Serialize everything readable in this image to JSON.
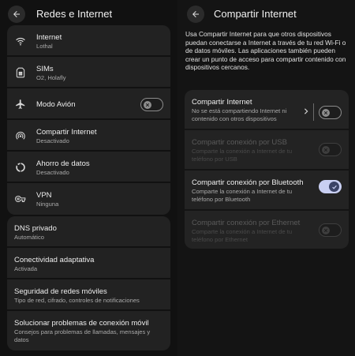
{
  "left": {
    "title": "Redes e Internet",
    "group1": [
      {
        "icon": "wifi-icon",
        "title": "Internet",
        "subtitle": "Lothal"
      },
      {
        "icon": "sim-card-icon",
        "title": "SIMs",
        "subtitle": "O2, Holafly"
      },
      {
        "icon": "airplane-icon",
        "title": "Modo Avión",
        "toggle": "off"
      },
      {
        "icon": "hotspot-icon",
        "title": "Compartir Internet",
        "subtitle": "Desactivado"
      },
      {
        "icon": "data-saver-icon",
        "title": "Ahorro de datos",
        "subtitle": "Desactivado"
      },
      {
        "icon": "vpn-key-icon",
        "title": "VPN",
        "subtitle": "Ninguna"
      }
    ],
    "group2": [
      {
        "title": "DNS privado",
        "subtitle": "Automático"
      },
      {
        "title": "Conectividad adaptativa",
        "subtitle": "Activada"
      },
      {
        "title": "Seguridad de redes móviles",
        "subtitle": "Tipo de red, cifrado, controles de notificaciones"
      },
      {
        "title": "Solucionar problemas de conexión móvil",
        "subtitle": "Consejos para problemas de llamadas, mensajes y datos"
      }
    ]
  },
  "right": {
    "title": "Compartir Internet",
    "intro": "Usa Compartir Internet para que otros dispositivos puedan conectarse a Internet a través de tu red Wi-Fi o de datos móviles. Las aplicaciones también pueden crear un punto de acceso para compartir contenido con dispositivos cercanos.",
    "options": [
      {
        "title": "Compartir Internet",
        "subtitle": "No se está compartiendo Internet ni contenido con otros dispositivos",
        "state": "off",
        "enabled": true
      },
      {
        "title": "Compartir conexión por USB",
        "subtitle": "Comparte la conexión a Internet de tu teléfono por USB",
        "state": "off",
        "enabled": false
      },
      {
        "title": "Compartir conexión por Bluetooth",
        "subtitle": "Comparte la conexión a Internet de tu teléfono por Bluetooth",
        "state": "on",
        "enabled": true
      },
      {
        "title": "Compartir conexión por Ethernet",
        "subtitle": "Comparte la conexión a Internet de tu teléfono por Ethernet",
        "state": "off",
        "enabled": false
      }
    ]
  },
  "colors": {
    "background": "#111111",
    "card": "#222222",
    "toggle_on_track": "#c9cff2",
    "toggle_on_knob": "#3b4366"
  }
}
